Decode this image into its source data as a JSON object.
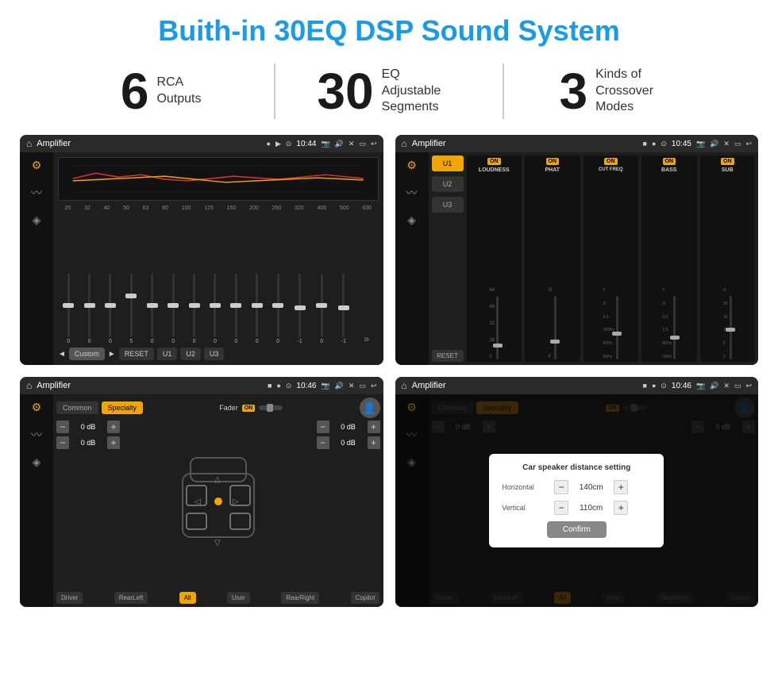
{
  "page": {
    "title": "Buith-in 30EQ DSP Sound System",
    "stats": [
      {
        "number": "6",
        "text": "RCA\nOutputs"
      },
      {
        "number": "30",
        "text": "EQ Adjustable\nSegments"
      },
      {
        "number": "3",
        "text": "Kinds of\nCrossover Modes"
      }
    ]
  },
  "screens": {
    "eq_screen": {
      "title": "Amplifier",
      "time": "10:44",
      "freq_labels": [
        "25",
        "32",
        "40",
        "50",
        "63",
        "80",
        "100",
        "125",
        "160",
        "200",
        "250",
        "320",
        "400",
        "500",
        "630"
      ],
      "slider_values": [
        "0",
        "0",
        "0",
        "5",
        "0",
        "0",
        "0",
        "0",
        "0",
        "0",
        "0",
        "-1",
        "0",
        "-1"
      ],
      "bottom_btns": [
        "Custom",
        "RESET",
        "U1",
        "U2",
        "U3"
      ]
    },
    "amp_screen": {
      "title": "Amplifier",
      "time": "10:45",
      "presets": [
        "U1",
        "U2",
        "U3"
      ],
      "channels": [
        {
          "name": "LOUDNESS",
          "on": true
        },
        {
          "name": "PHAT",
          "on": true
        },
        {
          "name": "CUT FREQ",
          "on": true
        },
        {
          "name": "BASS",
          "on": true
        },
        {
          "name": "SUB",
          "on": true
        }
      ]
    },
    "cs_screen": {
      "title": "Amplifier",
      "time": "10:46",
      "tabs": [
        "Common",
        "Specialty"
      ],
      "fader_label": "Fader",
      "db_values": [
        "0 dB",
        "0 dB",
        "0 dB",
        "0 dB"
      ],
      "bottom_btns": [
        "Driver",
        "RearLeft",
        "All",
        "User",
        "RearRight",
        "Copilot"
      ]
    },
    "dialog_screen": {
      "title": "Amplifier",
      "time": "10:46",
      "tabs": [
        "Common",
        "Specialty"
      ],
      "dialog": {
        "title": "Car speaker distance setting",
        "horizontal_label": "Horizontal",
        "horizontal_value": "140cm",
        "vertical_label": "Vertical",
        "vertical_value": "110cm",
        "confirm_label": "Confirm"
      },
      "db_values": [
        "0 dB",
        "0 dB"
      ],
      "bottom_btns": [
        "Driver",
        "RearLeft",
        "All",
        "User",
        "RearRight",
        "Copilot"
      ]
    }
  },
  "icons": {
    "home": "⌂",
    "settings": "≡",
    "play": "▶",
    "back": "↩",
    "sound": "♪",
    "wave": "〰",
    "speaker": "▐",
    "location": "📍",
    "camera": "📷",
    "volume": "🔊",
    "close": "✕",
    "minus": "□",
    "arrow": "↺",
    "expand": "⊞",
    "arrow_right": "►",
    "arrow_left": "◄",
    "arrow_forward": "▶",
    "arrow_double": "»"
  }
}
